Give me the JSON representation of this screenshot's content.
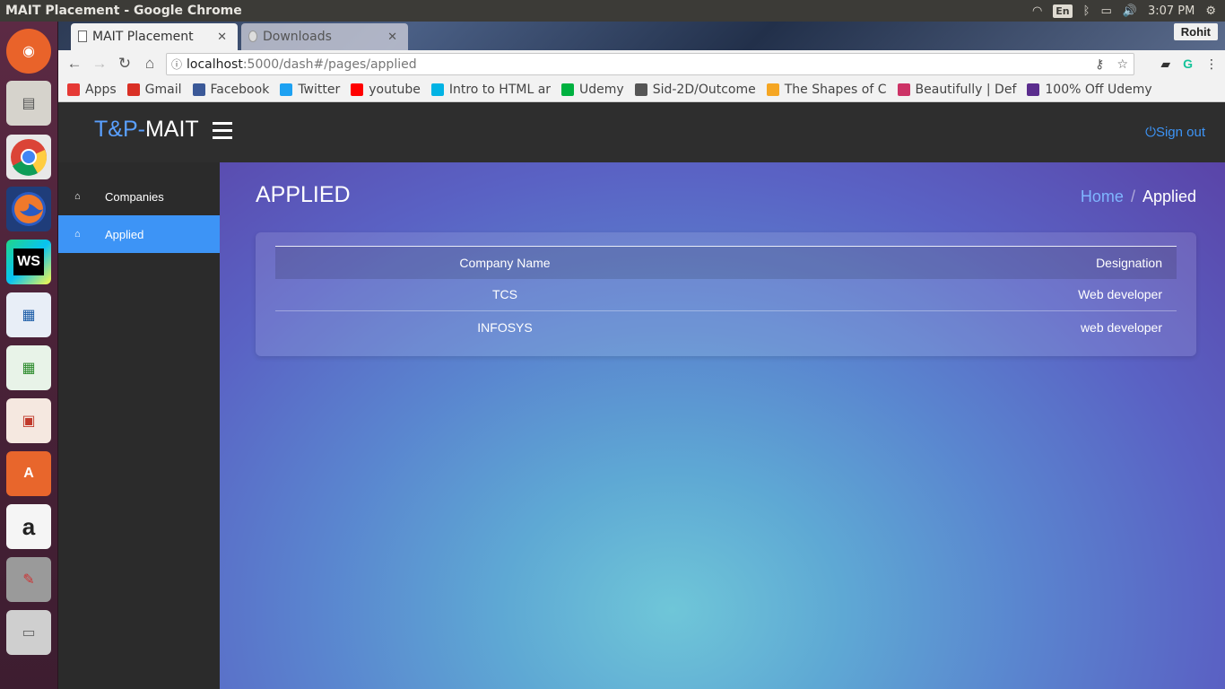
{
  "os": {
    "window_title": "MAIT Placement - Google Chrome",
    "keyboard_layout": "En",
    "clock": "3:07 PM"
  },
  "launcher": {
    "items": [
      "ubuntu-dash-icon",
      "files-icon",
      "chrome-icon",
      "firefox-icon",
      "webstorm-icon",
      "writer-icon",
      "calc-icon",
      "impress-icon",
      "software-center-icon",
      "amazon-icon",
      "system-settings-icon",
      "drive-icon"
    ]
  },
  "browser": {
    "tabs": [
      {
        "label": "MAIT Placement",
        "active": true
      },
      {
        "label": "Downloads",
        "active": false
      }
    ],
    "profile": "Rohit",
    "url_host": "localhost",
    "url_path": ":5000/dash#/pages/applied",
    "bookmarks": [
      {
        "label": "Apps",
        "color": "#e53935"
      },
      {
        "label": "Gmail",
        "color": "#d93025"
      },
      {
        "label": "Facebook",
        "color": "#3b5998"
      },
      {
        "label": "Twitter",
        "color": "#1da1f2"
      },
      {
        "label": "youtube",
        "color": "#ff0000"
      },
      {
        "label": "Intro to HTML ar",
        "color": "#02b3e4"
      },
      {
        "label": "Udemy",
        "color": "#00b140"
      },
      {
        "label": "Sid-2D/Outcome",
        "color": "#555555"
      },
      {
        "label": "The Shapes of C",
        "color": "#f5a623"
      },
      {
        "label": "Beautifully | Def",
        "color": "#cc3366"
      },
      {
        "label": "100% Off Udemy",
        "color": "#5b2d8e"
      }
    ]
  },
  "header": {
    "brand_accent": "T&P-",
    "brand_main": "MAIT",
    "signout_icon": "⏻",
    "signout_label": "Sign out"
  },
  "sidebar": {
    "items": [
      {
        "label": "Companies",
        "icon": "home-icon"
      },
      {
        "label": "Applied",
        "icon": "home-icon",
        "active": true
      }
    ]
  },
  "main": {
    "title": "APPLIED",
    "breadcrumb": {
      "home": "Home",
      "separator": "/",
      "current": "Applied"
    },
    "table": {
      "headers": [
        "Company Name",
        "Designation"
      ],
      "rows": [
        [
          "TCS",
          "Web developer"
        ],
        [
          "INFOSYS",
          "web developer"
        ]
      ]
    }
  },
  "colors": {
    "accent": "#3d94f6",
    "header_bg": "#2e2e2e",
    "sidebar_bg": "#2b2b2b"
  }
}
